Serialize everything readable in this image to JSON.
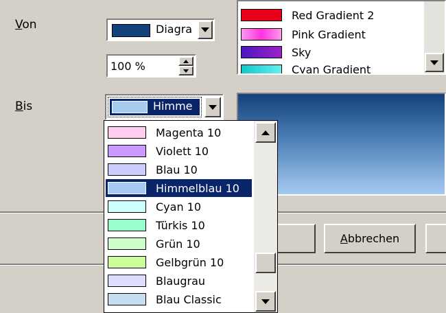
{
  "von": {
    "label_u": "V",
    "label_rest": "on",
    "combo_value": "Diagra",
    "combo_color": "#13417c",
    "percent_value": "100 %"
  },
  "bis": {
    "label_u": "B",
    "label_rest": "is",
    "combo_value": "Himme",
    "combo_color": "#a6caf0"
  },
  "gradient_list": {
    "items": [
      {
        "label": "Red Gradient 2",
        "color": "#e8001a"
      },
      {
        "label": "Pink Gradient",
        "color": "#ff55dd"
      },
      {
        "label": "Sky",
        "color": "#7a1ec8"
      },
      {
        "label": "Cyan Gradient",
        "color": "#22d4d4"
      }
    ]
  },
  "preview": {
    "gradient_from": "#13417c",
    "gradient_to": "#a6caf0"
  },
  "dropdown": {
    "items": [
      {
        "label": "Magenta 10",
        "color": "#ffccf0"
      },
      {
        "label": "Violett 10",
        "color": "#cc99ff"
      },
      {
        "label": "Blau 10",
        "color": "#ccccff"
      },
      {
        "label": "Himmelblau 10",
        "color": "#a6caf0",
        "selected": true
      },
      {
        "label": "Cyan 10",
        "color": "#ccffff"
      },
      {
        "label": "Türkis 10",
        "color": "#99ffcc"
      },
      {
        "label": "Grün 10",
        "color": "#ccffcc"
      },
      {
        "label": "Gelbgrün 10",
        "color": "#ccff99"
      },
      {
        "label": "Blaugrau",
        "color": "#ddddff"
      },
      {
        "label": "Blau Classic",
        "color": "#c6ddf0"
      }
    ]
  },
  "buttons": {
    "cancel_u": "A",
    "cancel_rest": "bbrechen"
  }
}
